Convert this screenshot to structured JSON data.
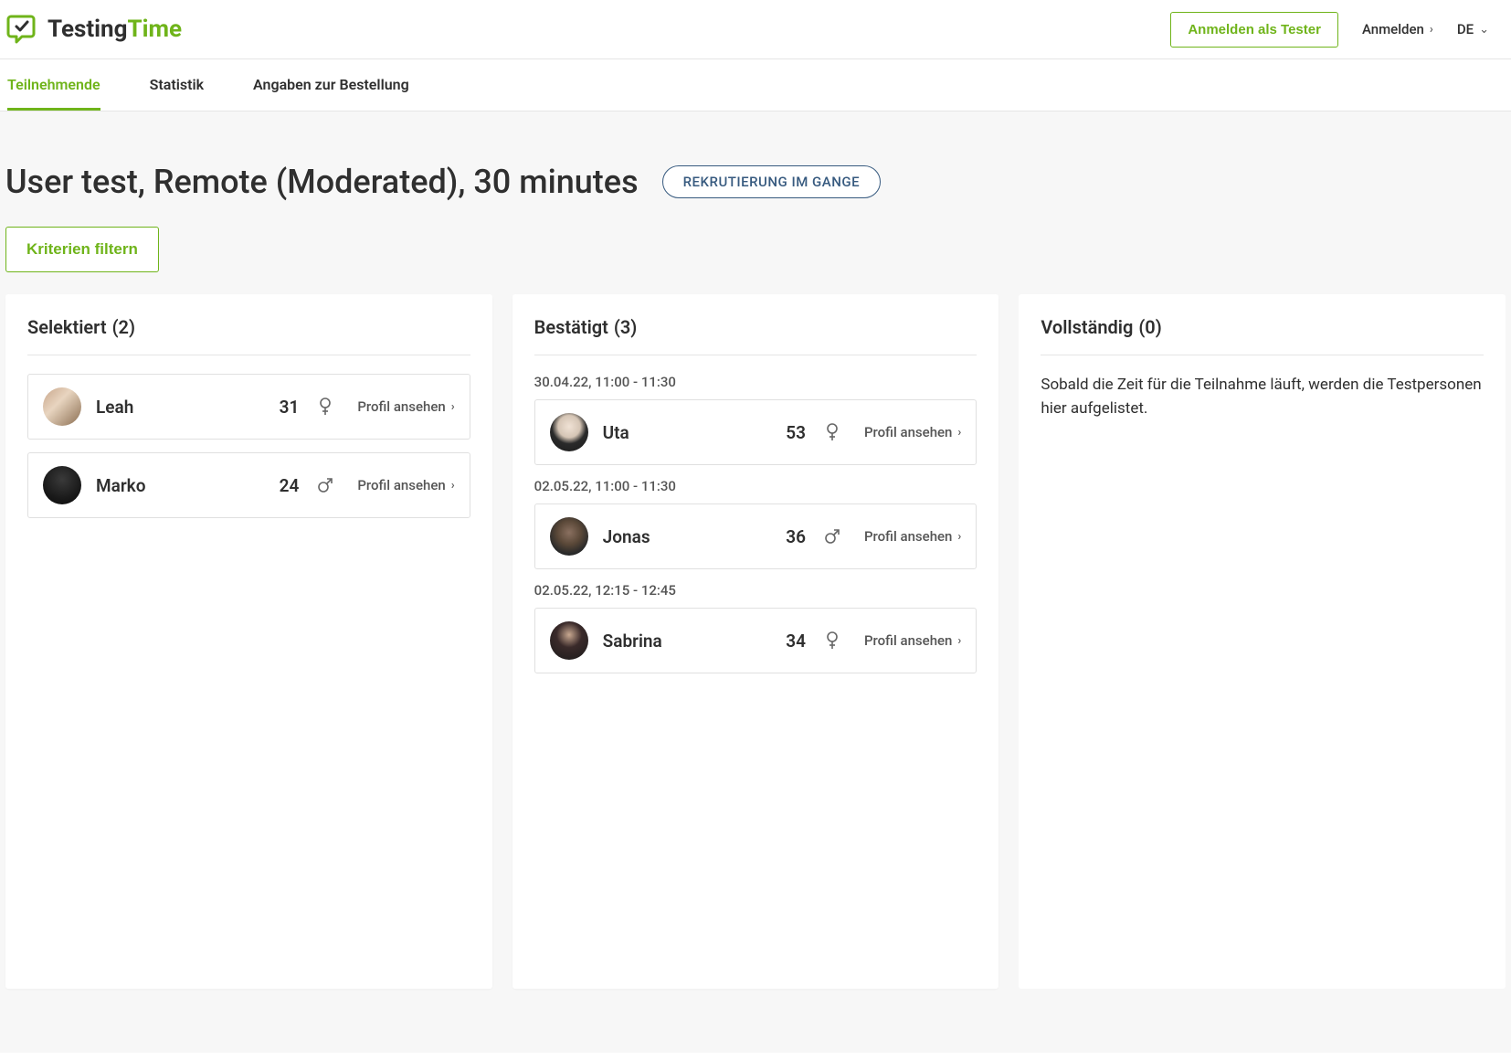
{
  "header": {
    "logo_part1": "Testing",
    "logo_part2": "Time",
    "register_tester": "Anmelden als Tester",
    "login": "Anmelden",
    "language": "DE"
  },
  "tabs": [
    {
      "label": "Teilnehmende",
      "active": true
    },
    {
      "label": "Statistik",
      "active": false
    },
    {
      "label": "Angaben zur Bestellung",
      "active": false
    }
  ],
  "title": "User test, Remote (Moderated), 30 minutes",
  "status_pill": "REKRUTIERUNG IM GANGE",
  "filter_button": "Kriterien filtern",
  "profile_link_text": "Profil ansehen",
  "columns": {
    "selected": {
      "title": "Selektiert",
      "count": "(2)",
      "participants": [
        {
          "name": "Leah",
          "age": "31",
          "gender": "female",
          "avatar": "a1"
        },
        {
          "name": "Marko",
          "age": "24",
          "gender": "male",
          "avatar": "a2"
        }
      ]
    },
    "confirmed": {
      "title": "Bestätigt",
      "count": "(3)",
      "slots": [
        {
          "time": "30.04.22, 11:00 - 11:30",
          "participant": {
            "name": "Uta",
            "age": "53",
            "gender": "female",
            "avatar": "a3"
          }
        },
        {
          "time": "02.05.22, 11:00 - 11:30",
          "participant": {
            "name": "Jonas",
            "age": "36",
            "gender": "male",
            "avatar": "a4"
          }
        },
        {
          "time": "02.05.22, 12:15 - 12:45",
          "participant": {
            "name": "Sabrina",
            "age": "34",
            "gender": "female",
            "avatar": "a5"
          }
        }
      ]
    },
    "complete": {
      "title": "Vollständig",
      "count": "(0)",
      "empty_text": "Sobald die Zeit für die Teilnahme läuft, werden die Testpersonen hier aufgelistet."
    }
  }
}
